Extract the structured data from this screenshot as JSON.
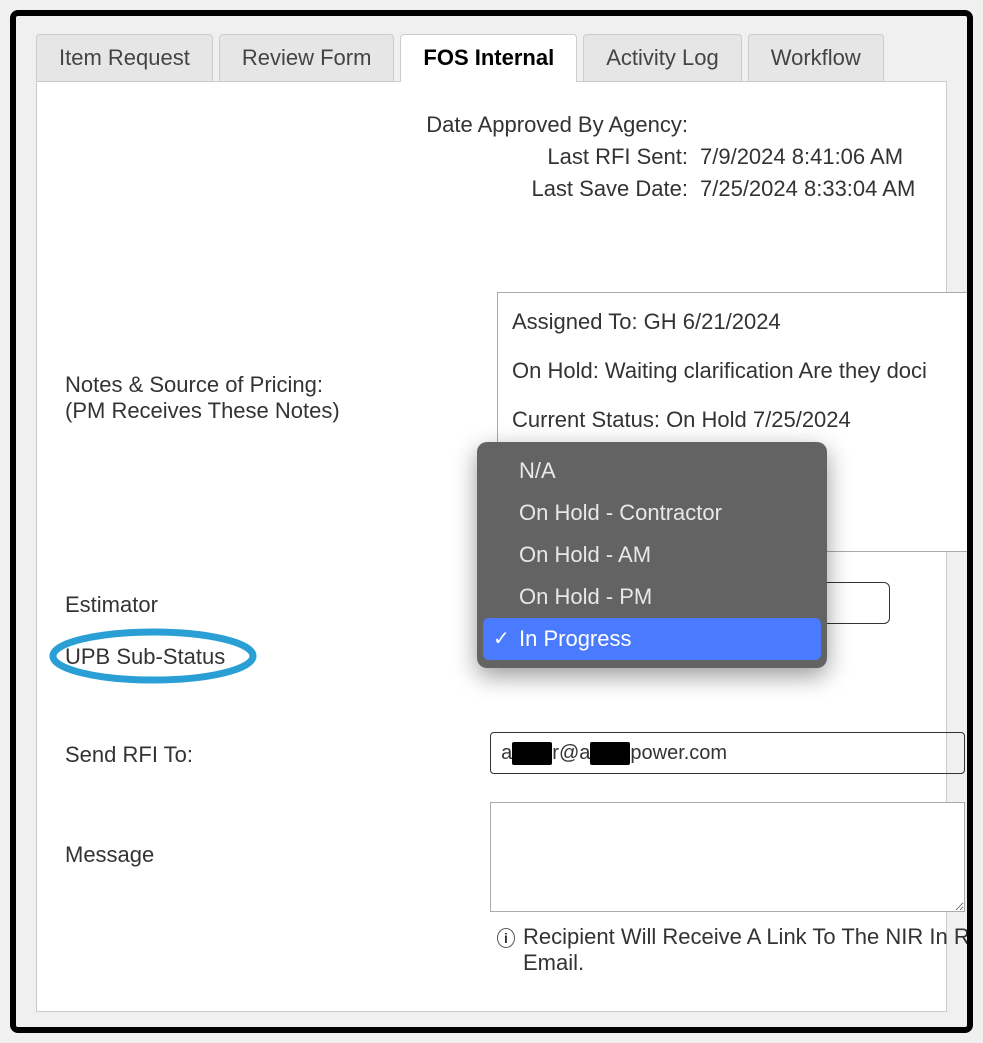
{
  "tabs": [
    {
      "label": "Item Request"
    },
    {
      "label": "Review Form"
    },
    {
      "label": "FOS Internal",
      "active": true
    },
    {
      "label": "Activity Log"
    },
    {
      "label": "Workflow"
    }
  ],
  "meta": {
    "date_approved_label": "Date Approved By Agency:",
    "date_approved_value": "",
    "last_rfi_label": "Last RFI Sent:",
    "last_rfi_value": "7/9/2024 8:41:06 AM",
    "last_save_label": "Last Save Date:",
    "last_save_value": "7/25/2024 8:33:04 AM"
  },
  "notes": {
    "label_line1": "Notes & Source of Pricing:",
    "label_line2": "(PM Receives These Notes)",
    "line1": "Assigned To: GH 6/21/2024",
    "line2": "On Hold: Waiting clarification Are they doci",
    "line3": "Current Status: On Hold 7/25/2024"
  },
  "fields": {
    "estimator_label": "Estimator",
    "estimator_value": "",
    "substatus_label": "UPB Sub-Status",
    "sendrfi_label": "Send RFI To:",
    "sendrfi_value_prefix": "a",
    "sendrfi_redact1": "xxxx",
    "sendrfi_mid": "r@a",
    "sendrfi_redact2": "xxxx",
    "sendrfi_suffix": "power.com",
    "message_label": "Message",
    "message_value": ""
  },
  "dropdown": {
    "options": [
      {
        "label": "N/A"
      },
      {
        "label": "On Hold - Contractor"
      },
      {
        "label": "On Hold - AM"
      },
      {
        "label": "On Hold - PM"
      },
      {
        "label": "In Progress",
        "selected": true
      }
    ]
  },
  "info": {
    "icon_text": "i",
    "body": "Recipient Will Receive A Link To The NIR In RFI Email."
  }
}
